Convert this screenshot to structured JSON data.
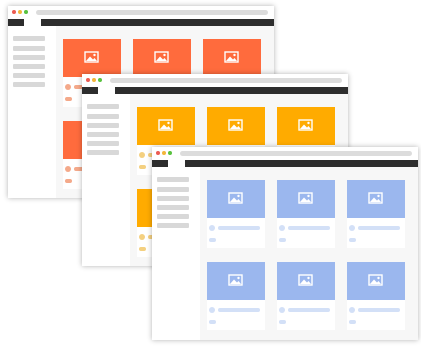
{
  "windows": [
    {
      "theme": "orange",
      "colors": {
        "thumb": "#ff6b3d",
        "accent": "#f4a98a"
      },
      "icon": "image-placeholder-icon",
      "sidebar_items": 6,
      "cards": 6
    },
    {
      "theme": "amber",
      "colors": {
        "thumb": "#ffab00",
        "accent": "#f4d080"
      },
      "icon": "image-placeholder-icon",
      "sidebar_items": 6,
      "cards": 6
    },
    {
      "theme": "blue",
      "colors": {
        "thumb": "#9bb7ee",
        "accent": "#d3e0f7"
      },
      "icon": "image-placeholder-icon",
      "sidebar_items": 6,
      "cards": 6
    }
  ],
  "window_chrome": {
    "traffic_lights": [
      "#ec5b52",
      "#f3b63a",
      "#58c23f"
    ],
    "nav_bar_color": "#2d2d2d"
  }
}
